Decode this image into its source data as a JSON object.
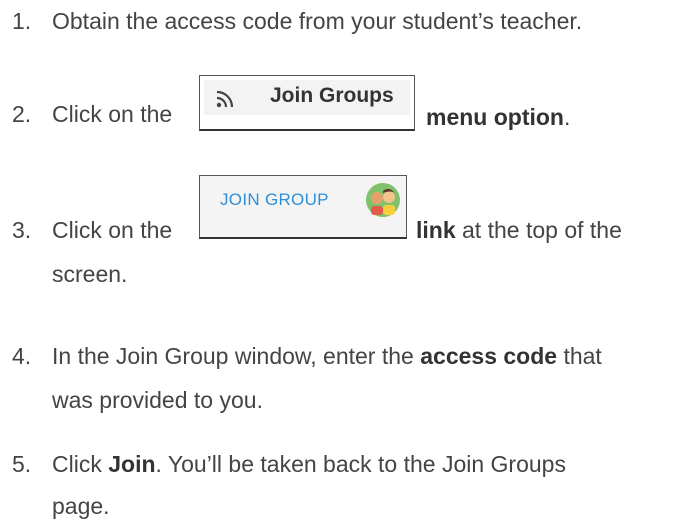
{
  "steps": [
    {
      "num": "1.",
      "text": "Obtain the access code from your student’s teacher."
    },
    {
      "num": "2.",
      "pre": "Click on the",
      "bold": "menu option",
      "post": ".",
      "button_label": "Join Groups",
      "button_icon": "rss-feed-icon"
    },
    {
      "num": "3.",
      "pre": "Click on the",
      "bold": "link",
      "post": " at the top of the",
      "continuation": "screen.",
      "link_label": "JOIN GROUP",
      "link_icon": "group-avatar-icon"
    },
    {
      "num": "4.",
      "pre": "In the Join Group window, enter the ",
      "bold": "access code",
      "post": " that",
      "continuation": "was provided to you."
    },
    {
      "num": "5.",
      "pre": "Click ",
      "bold": "Join",
      "post": ". You’ll be taken back to the Join Groups",
      "continuation": "page."
    }
  ],
  "colors": {
    "text": "#444444",
    "link_blue": "#2e8fd8",
    "button_bg": "#f3f3f3"
  }
}
